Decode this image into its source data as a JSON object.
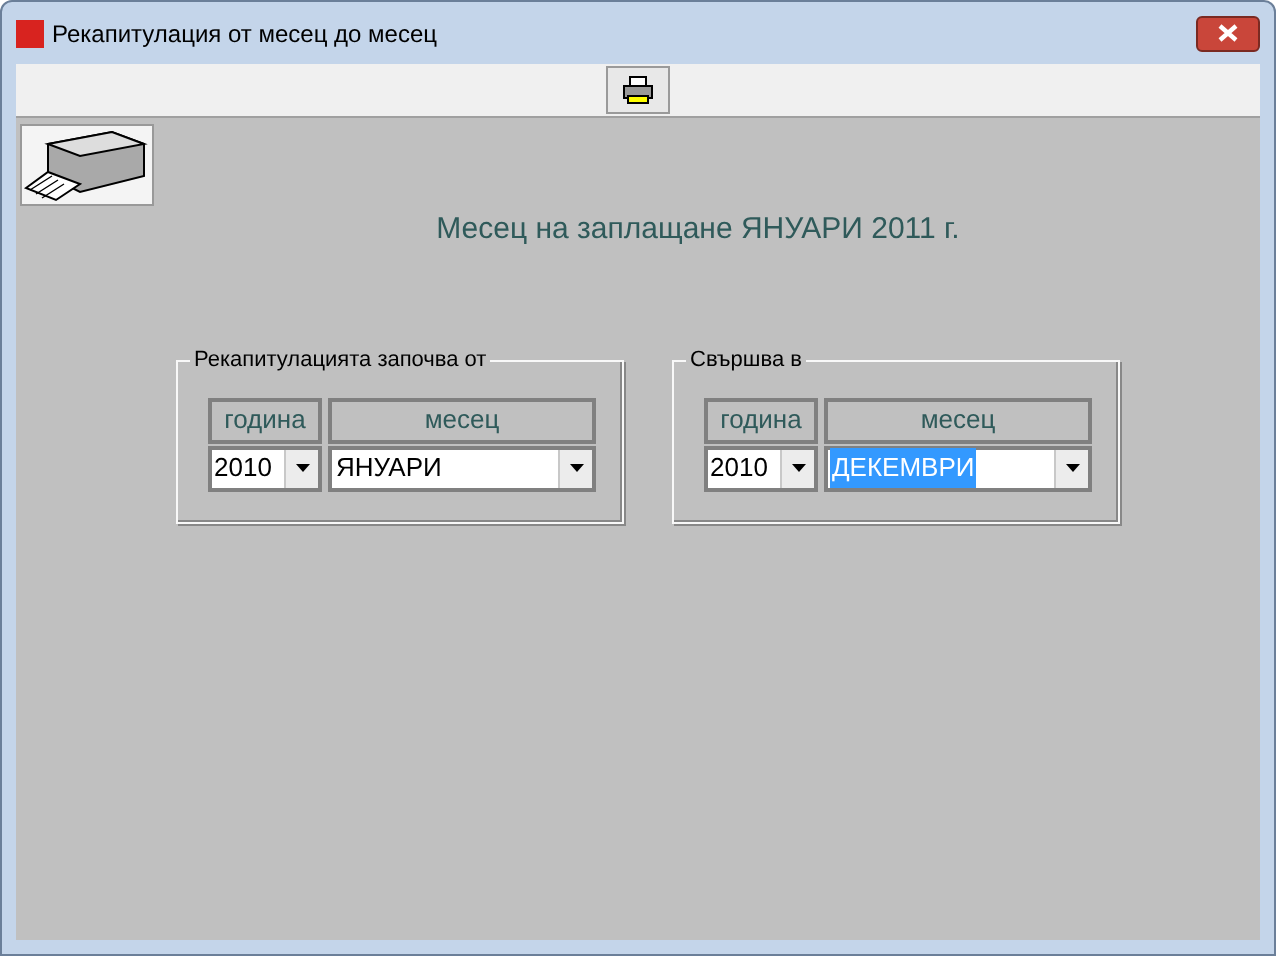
{
  "window": {
    "title": "Рекапитулация от месец до месец"
  },
  "heading": "Месец на заплащане ЯНУАРИ 2011 г.",
  "ranges": [
    {
      "title": "Рекапитулацията започва от",
      "columns": [
        "година",
        "месец"
      ],
      "year": "2010",
      "month": "ЯНУАРИ",
      "month_highlighted": false
    },
    {
      "title": "Свършва в",
      "columns": [
        "година",
        "месец"
      ],
      "year": "2010",
      "month": "ДЕКЕМВРИ",
      "month_highlighted": true
    }
  ]
}
